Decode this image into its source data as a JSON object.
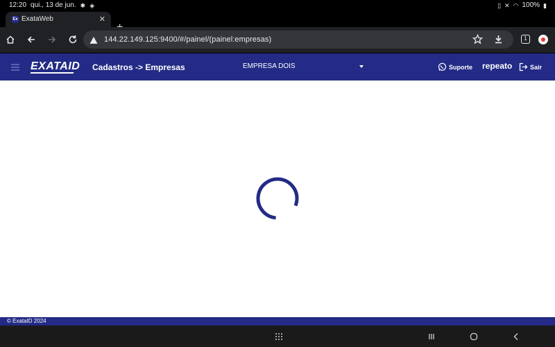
{
  "status_bar": {
    "time": "12:20",
    "date": "qui., 13 de jun.",
    "battery": "100%"
  },
  "browser": {
    "tab_title": "ExataWeb",
    "favicon_text": "Ex",
    "url": "144.22.149.125:9400/#/painel/(painel:empresas)",
    "open_tabs": "1"
  },
  "app": {
    "logo_text": "EXATA",
    "logo_suffix": "ID",
    "breadcrumb": "Cadastros -> Empresas",
    "company": "EMPRESA DOIS",
    "support_label": "Suporte",
    "username": "repeato",
    "logout_label": "Sair",
    "footer": "© ExataID 2024"
  },
  "colors": {
    "brand": "#232b86",
    "spinner": "#232b86"
  }
}
